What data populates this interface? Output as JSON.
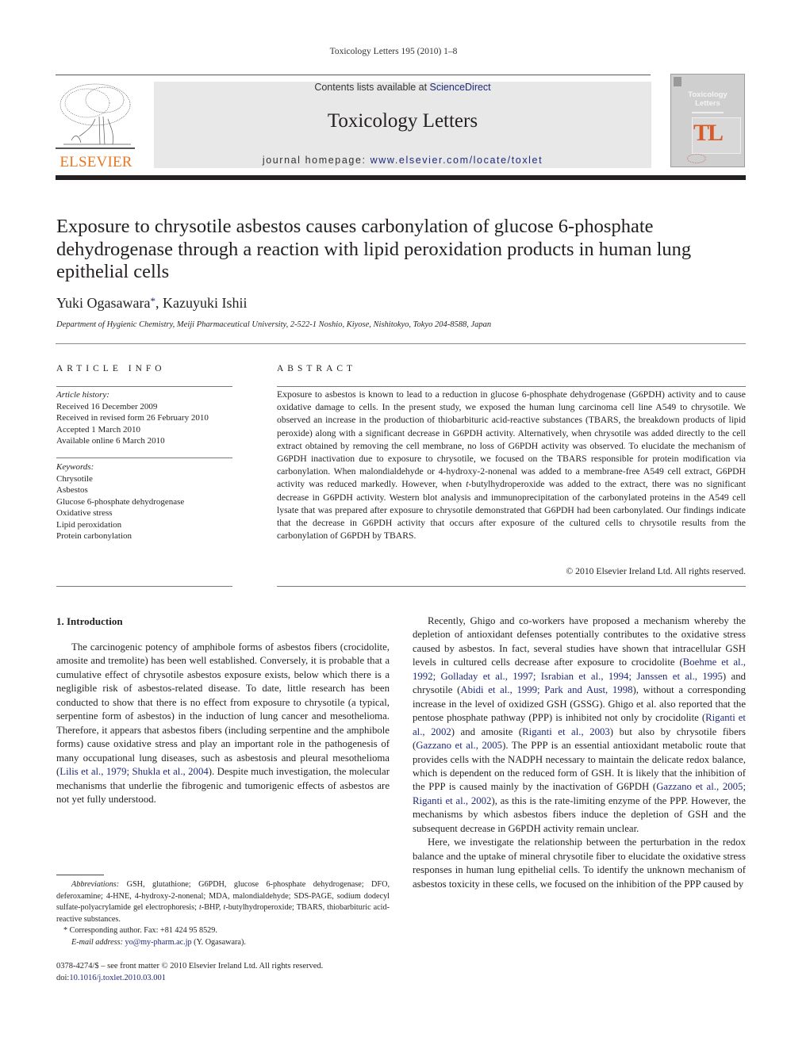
{
  "running_head": "Toxicology Letters 195 (2010) 1–8",
  "publisher": {
    "logo_word": "ELSEVIER",
    "logo_color": "#e87722"
  },
  "banner": {
    "contents_prefix": "Contents lists available at ",
    "contents_link": "ScienceDirect",
    "journal_title": "Toxicology Letters",
    "homepage_prefix": "journal homepage: ",
    "homepage_link": "www.elsevier.com/locate/toxlet"
  },
  "cover": {
    "title_line1": "Toxicology",
    "title_line2": "Letters",
    "monogram": "TL"
  },
  "article": {
    "title": "Exposure to chrysotile asbestos causes carbonylation of glucose 6-phosphate dehydrogenase through a reaction with lipid peroxidation products in human lung epithelial cells",
    "authors": [
      {
        "name": "Yuki Ogasawara",
        "mark": "*"
      },
      {
        "name": "Kazuyuki Ishii",
        "mark": ""
      }
    ],
    "author_separator": ", ",
    "affiliation": "Department of Hygienic Chemistry, Meiji Pharmaceutical University, 2-522-1 Noshio, Kiyose, Nishitokyo, Tokyo 204-8588, Japan"
  },
  "article_info": {
    "label": "ARTICLE INFO",
    "history_label": "Article history:",
    "history": [
      "Received 16 December 2009",
      "Received in revised form 26 February 2010",
      "Accepted 1 March 2010",
      "Available online 6 March 2010"
    ],
    "keywords_label": "Keywords:",
    "keywords": [
      "Chrysotile",
      "Asbestos",
      "Glucose 6-phosphate dehydrogenase",
      "Oxidative stress",
      "Lipid peroxidation",
      "Protein carbonylation"
    ]
  },
  "abstract": {
    "label": "ABSTRACT",
    "text_part1": "Exposure to asbestos is known to lead to a reduction in glucose 6-phosphate dehydrogenase (G6PDH) activity and to cause oxidative damage to cells. In the present study, we exposed the human lung carcinoma cell line A549 to chrysotile. We observed an increase in the production of thiobarbituric acid-reactive substances (TBARS, the breakdown products of lipid peroxide) along with a significant decrease in G6PDH activity. Alternatively, when chrysotile was added directly to the cell extract obtained by removing the cell membrane, no loss of G6PDH activity was observed. To elucidate the mechanism of G6PDH inactivation due to exposure to chrysotile, we focused on the TBARS responsible for protein modification via carbonylation. When malondialdehyde or 4-hydroxy-2-nonenal was added to a membrane-free A549 cell extract, G6PDH activity was reduced markedly. However, when ",
    "text_italic": "t",
    "text_part2": "-butylhydroperoxide was added to the extract, there was no significant decrease in G6PDH activity. Western blot analysis and immunoprecipitation of the carbonylated proteins in the A549 cell lysate that was prepared after exposure to chrysotile demonstrated that G6PDH had been carbonylated. Our findings indicate that the decrease in G6PDH activity that occurs after exposure of the cultured cells to chrysotile results from the carbonylation of G6PDH by TBARS.",
    "copyright": "© 2010 Elsevier Ireland Ltd. All rights reserved."
  },
  "introduction": {
    "heading": "1.  Introduction",
    "p1_a": "The carcinogenic potency of amphibole forms of asbestos fibers (crocidolite, amosite and tremolite) has been well established. Conversely, it is probable that a cumulative effect of chrysotile asbestos exposure exists, below which there is a negligible risk of asbestos-related disease. To date, little research has been conducted to show that there is no effect from exposure to chrysotile (a typical, serpentine form of asbestos) in the induction of lung cancer and mesothelioma. Therefore, it appears that asbestos fibers (including serpentine and the amphibole forms) cause oxidative stress and play an important role in the pathogenesis of many occupational lung diseases, such as asbestosis and pleural mesothelioma (",
    "p1_cite": "Lilis et al., 1979; Shukla et al., 2004",
    "p1_b": "). Despite much investigation, the molecular mechanisms that underlie the fibrogenic and tumorigenic effects of asbestos are not yet fully understood.",
    "p2_a": "Recently, Ghigo and co-workers have proposed a mechanism whereby the depletion of antioxidant defenses potentially contributes to the oxidative stress caused by asbestos. In fact, several studies have shown that intracellular GSH levels in cultured cells decrease after exposure to crocidolite (",
    "p2_cite1": "Boehme et al., 1992; Golladay et al., 1997; Israbian et al., 1994; Janssen et al., 1995",
    "p2_b": ") and chrysotile (",
    "p2_cite2": "Abidi et al., 1999; Park and Aust, 1998",
    "p2_c": "), without a corresponding increase in the level of oxidized GSH (GSSG). Ghigo et al. also reported that the pentose phosphate pathway (PPP) is inhibited not only by crocidolite (",
    "p2_cite3": "Riganti et al., 2002",
    "p2_d": ") and amosite (",
    "p2_cite4": "Riganti et al., 2003",
    "p2_e": ") but also by chrysotile fibers (",
    "p2_cite5": "Gazzano et al., 2005",
    "p2_f": "). The PPP is an essential antioxidant metabolic route that provides cells with the NADPH necessary to maintain the delicate redox balance, which is dependent on the reduced form of GSH. It is likely that the inhibition of the PPP is caused mainly by the inactivation of G6PDH (",
    "p2_cite6": "Gazzano et al., 2005; Riganti et al., 2002",
    "p2_g": "), as this is the rate-limiting enzyme of the PPP. However, the mechanisms by which asbestos fibers induce the depletion of GSH and the subsequent decrease in G6PDH activity remain unclear.",
    "p3": "Here, we investigate the relationship between the perturbation in the redox balance and the uptake of mineral chrysotile fiber to elucidate the oxidative stress responses in human lung epithelial cells. To identify the unknown mechanism of asbestos toxicity in these cells, we focused on the inhibition of the PPP caused by"
  },
  "footnotes": {
    "abbrev_label": "Abbreviations:",
    "abbrev_a": "  GSH, glutathione; G6PDH, glucose 6-phosphate dehydrogenase; DFO, deferoxamine; 4-HNE, 4-hydroxy-2-nonenal; MDA, malondialdehyde; SDS-PAGE, sodium dodecyl sulfate-polyacrylamide gel electrophoresis; ",
    "abbrev_t1": "t",
    "abbrev_b": "-BHP, ",
    "abbrev_t2": "t",
    "abbrev_c": "-butylhydroperoxide; TBARS, thiobarbituric acid-reactive substances.",
    "corresponding": "* Corresponding author. Fax: +81 424 95 8529.",
    "email_label": "E-mail address:",
    "email": "yo@my-pharm.ac.jp",
    "email_suffix": " (Y. Ogasawara)."
  },
  "front_matter": {
    "issn_line": "0378-4274/$ – see front matter © 2010 Elsevier Ireland Ltd. All rights reserved.",
    "doi_prefix": "doi:",
    "doi": "10.1016/j.toxlet.2010.03.001"
  }
}
